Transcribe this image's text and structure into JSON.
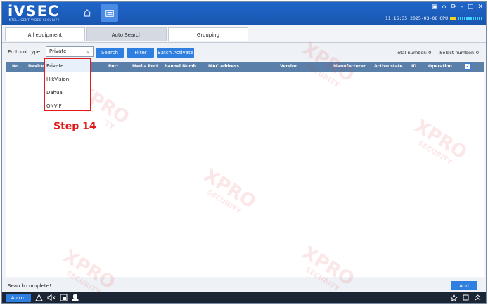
{
  "header": {
    "logo_text": "iVSEC",
    "logo_tagline": "INTELLIGENT VIDEO SECURITY",
    "datetime": "11:16:35 2025-03-06",
    "cpu_label": "CPU"
  },
  "tabs": [
    {
      "label": "All equipment",
      "active": true
    },
    {
      "label": "Auto Search",
      "active": false
    },
    {
      "label": "Grouping",
      "active": true
    }
  ],
  "toolbar": {
    "protocol_label": "Protocol type:",
    "protocol_value": "Private",
    "search_label": "Search",
    "filter_label": "Filter",
    "batch_label": "Batch Activate",
    "total_number": "Total number: 0",
    "select_number": "Select number: 0"
  },
  "table": {
    "columns": [
      "No.",
      "Device",
      "Port",
      "Media Port",
      "hannel Numb",
      "MAC address",
      "Version",
      "Manufacturer",
      "Active state",
      "ID",
      "Operation"
    ]
  },
  "dropdown": {
    "options": [
      "Private",
      "HikVision",
      "Dahua",
      "ONVIF"
    ]
  },
  "annotation": {
    "step_label": "Step 14"
  },
  "watermark": {
    "main": "XPRO",
    "sub": "SECURITY"
  },
  "statusbar": {
    "status": "Search complete!",
    "add_label": "Add"
  },
  "bottombar": {
    "alarm_label": "Alarm"
  },
  "colors": {
    "header_blue": "#1f66c9",
    "button_blue": "#2f7fe0",
    "table_header": "#5a7fa8",
    "highlight_red": "#e21a1a"
  }
}
